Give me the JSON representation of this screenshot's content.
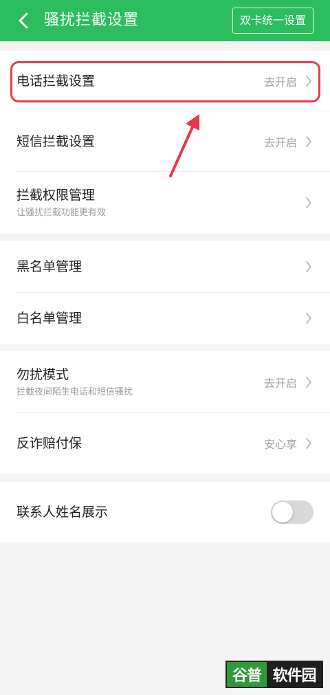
{
  "header": {
    "title": "骚扰拦截设置",
    "dual_card_button": "双卡统一设置"
  },
  "groups": [
    {
      "rows": [
        {
          "title": "电话拦截设置",
          "value": "去开启"
        },
        {
          "title": "短信拦截设置",
          "value": "去开启"
        },
        {
          "title": "拦截权限管理",
          "subtitle": "让骚扰拦截功能更有效"
        }
      ]
    },
    {
      "rows": [
        {
          "title": "黑名单管理"
        },
        {
          "title": "白名单管理"
        }
      ]
    },
    {
      "rows": [
        {
          "title": "勿扰模式",
          "subtitle": "拦截夜间陌生电话和短信骚扰",
          "value": "去开启"
        },
        {
          "title": "反诈赔付保",
          "value": "安心享"
        }
      ]
    },
    {
      "rows": [
        {
          "title": "联系人姓名展示",
          "toggle_on": false
        }
      ]
    }
  ],
  "watermark": {
    "part1": "谷普",
    "part2": "软件园"
  },
  "colors": {
    "header_green": "#2bbd5e",
    "highlight_red": "#e8384a"
  }
}
